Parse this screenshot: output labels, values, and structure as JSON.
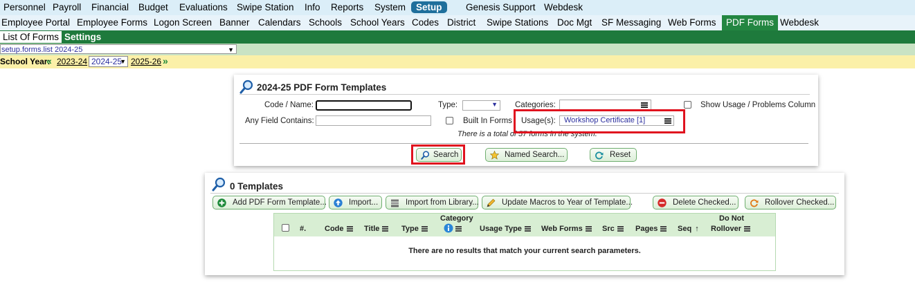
{
  "nav_main": {
    "items": [
      "Personnel",
      "Payroll",
      "Financial",
      "Budget",
      "Evaluations",
      "Swipe Station",
      "Info",
      "Reports",
      "System",
      "Setup",
      "Genesis Support",
      "Webdesk"
    ],
    "active": "Setup"
  },
  "nav_sub": {
    "items": [
      "Employee Portal",
      "Employee Forms",
      "Logon Screen",
      "Banner",
      "Calendars",
      "Schools",
      "School Years",
      "Codes",
      "District",
      "Swipe Stations",
      "Doc Mgt",
      "SF Messaging",
      "Web Forms",
      "PDF Forms",
      "Webdesk"
    ],
    "active": "PDF Forms"
  },
  "tabs": {
    "list_of_forms": "List Of Forms",
    "settings": "Settings"
  },
  "screen_select": "setup.forms.list 2024-25",
  "school_year": {
    "label": "School Year:",
    "prev": "2023-24",
    "current": "2024-25",
    "next": "2025-26"
  },
  "search_panel": {
    "title": "2024-25 PDF Form Templates",
    "code_name_label": "Code / Name:",
    "type_label": "Type:",
    "categories_label": "Categories:",
    "show_usage_label": "Show Usage / Problems Column",
    "any_field_label": "Any Field Contains:",
    "built_in_label": "Built In Forms",
    "usage_label": "Usage(s):",
    "usage_value": "Workshop Certificate [1]",
    "total_text": "There is a total of 57 forms in the system.",
    "search_button": "Search",
    "named_search_button": "Named Search...",
    "reset_button": "Reset"
  },
  "templates_panel": {
    "title": "0 Templates",
    "buttons": {
      "add": "Add PDF Form Template...",
      "import": "Import...",
      "import_library": "Import from Library...",
      "update_macros": "Update Macros to Year of Template...",
      "delete_checked": "Delete Checked...",
      "rollover_checked": "Rollover Checked..."
    },
    "columns": {
      "num": "#.",
      "code": "Code",
      "title": "Title",
      "type": "Type",
      "category": "Category",
      "usage_type": "Usage Type",
      "web_forms": "Web Forms",
      "src": "Src",
      "pages": "Pages",
      "seq": "Seq",
      "do_not": "Do Not",
      "rollover": "Rollover"
    },
    "empty_message": "There are no results that match your current search parameters."
  },
  "colors": {
    "nav_bg": "#dbeef8",
    "setup_active": "#1f6f9c",
    "green_bar": "#1e7a3c",
    "year_bar": "#fbf0a8",
    "highlight": "#e0121e"
  }
}
